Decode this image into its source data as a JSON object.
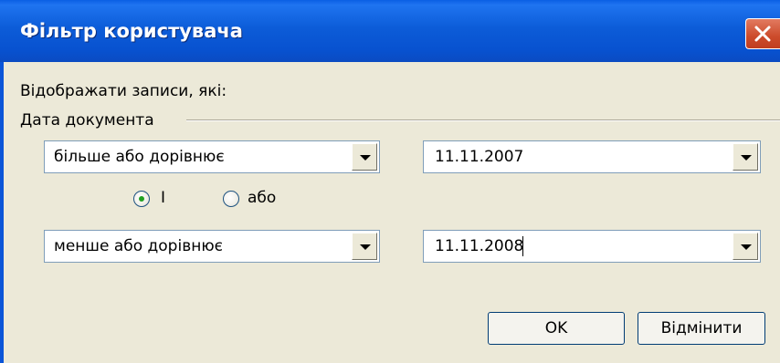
{
  "window": {
    "title": "Фільтр користувача"
  },
  "dialog": {
    "heading": "Відображати записи, які:",
    "group_label": "Дата документа",
    "condition1": {
      "operator": "більше або дорівнює",
      "value": "11.11.2007"
    },
    "logic": {
      "option_and": "І",
      "option_or": "або",
      "selected": "І"
    },
    "condition2": {
      "operator": "менше або дорівнює",
      "value": "11.11.2008"
    },
    "ok_label": "OK",
    "cancel_label": "Відмінити"
  },
  "colors": {
    "titlebar": "#0a5fe4",
    "close": "#cc4b2b",
    "face": "#ece9d8",
    "radio_dot": "#21a121"
  },
  "icons": {
    "close": "close-icon",
    "dropdown": "chevron-down-icon"
  }
}
